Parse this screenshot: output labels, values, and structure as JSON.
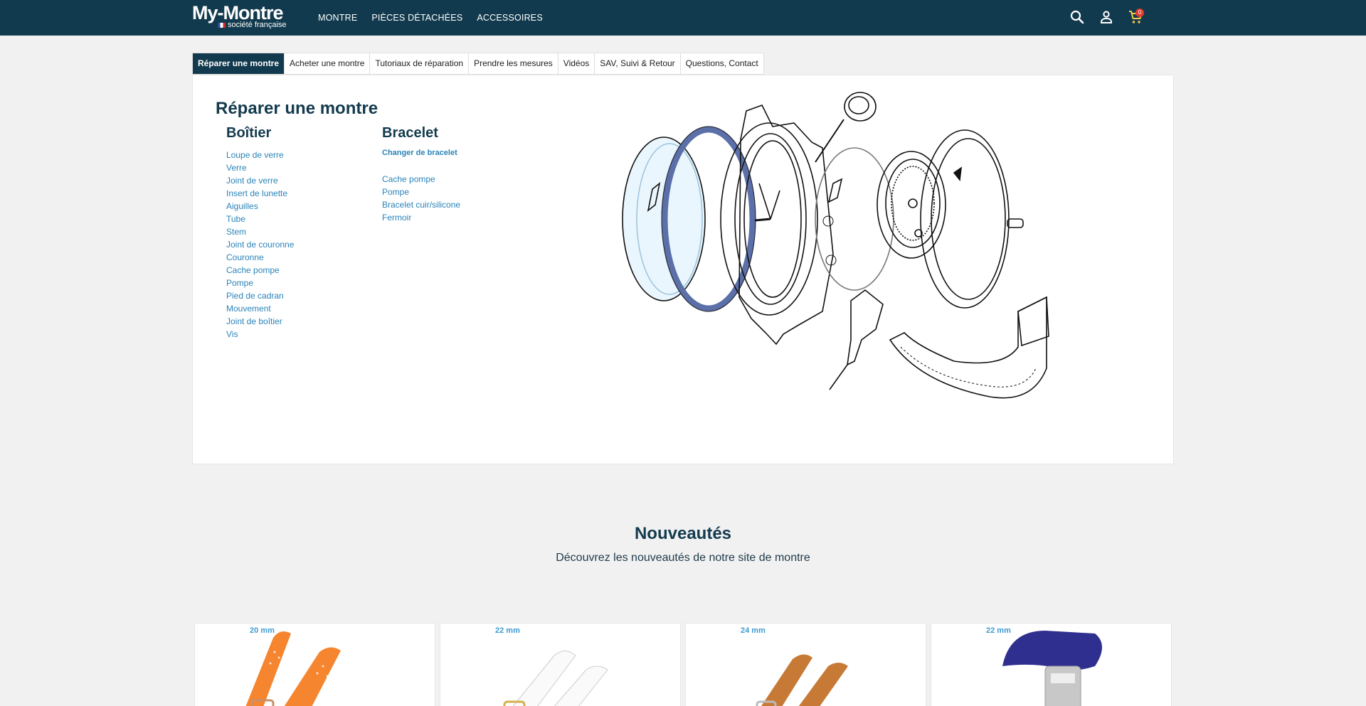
{
  "header": {
    "logo_main": "My-Montre",
    "logo_sub": "société française",
    "nav": [
      "MONTRE",
      "PIÈCES DÉTACHÉES",
      "ACCESSOIRES"
    ],
    "cart_count": "0",
    "colors": {
      "bar": "#123a4e",
      "accent_cart": "#f2c94c",
      "badge": "#e23b2e"
    },
    "icons": [
      "search-icon",
      "user-icon",
      "cart-icon"
    ]
  },
  "tabs": [
    {
      "label": "Réparer une montre",
      "active": true
    },
    {
      "label": "Acheter une montre"
    },
    {
      "label": "Tutoriaux de réparation"
    },
    {
      "label": "Prendre les mesures"
    },
    {
      "label": "Vidéos"
    },
    {
      "label": "SAV, Suivi & Retour"
    },
    {
      "label": "Questions, Contact"
    }
  ],
  "panel": {
    "title": "Réparer une montre",
    "boitier": {
      "heading": "Boîtier",
      "links": [
        "Loupe de verre",
        "Verre",
        "Joint de verre",
        "Insert de lunette",
        "Aiguilles",
        "Tube",
        "Stem",
        "Joint de couronne",
        "Couronne",
        "Cache pompe",
        "Pompe",
        "Pied de cadran",
        "Mouvement",
        "Joint de boîtier",
        "Vis"
      ]
    },
    "bracelet": {
      "heading": "Bracelet",
      "featured": "Changer de bracelet",
      "links": [
        "Cache pompe",
        "Pompe",
        "Bracelet cuir/silicone",
        "Fermoir"
      ]
    }
  },
  "news": {
    "title": "Nouveautés",
    "subtitle": "Découvrez les nouveautés de notre site de montre"
  },
  "products": [
    {
      "size": "20 mm",
      "color": "#f5852e"
    },
    {
      "size": "22 mm",
      "color": "#ffffff"
    },
    {
      "size": "24 mm",
      "color": "#c77a36"
    },
    {
      "size": "22 mm",
      "color": "#2f2f8f"
    }
  ]
}
